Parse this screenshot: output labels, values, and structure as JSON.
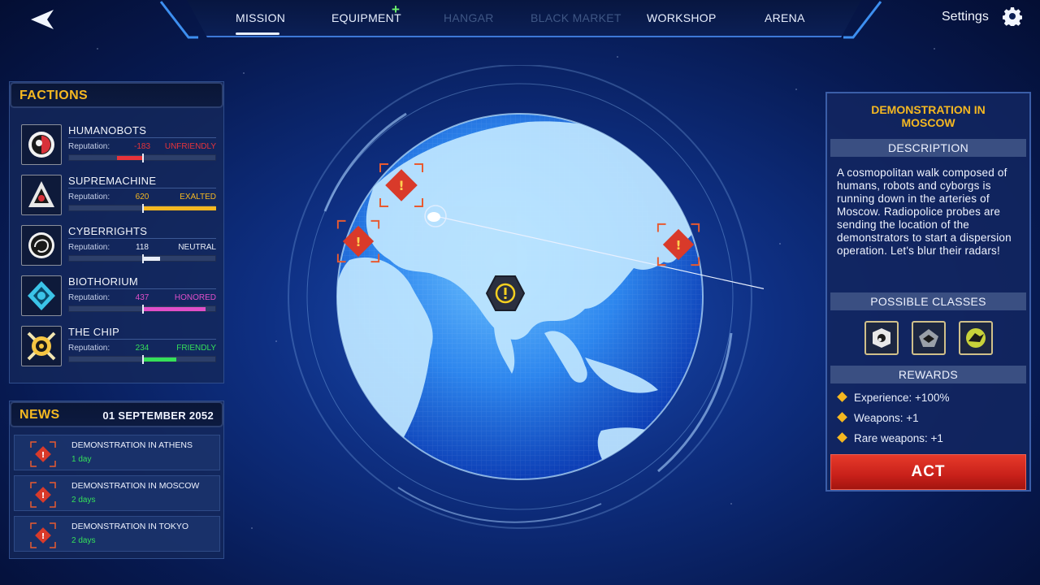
{
  "nav": {
    "tabs": [
      {
        "label": "MISSION",
        "state": "active"
      },
      {
        "label": "EQUIPMENT",
        "state": "normal"
      },
      {
        "label": "HANGAR",
        "state": "disabled"
      },
      {
        "label": "BLACK MARKET",
        "state": "disabled"
      },
      {
        "label": "WORKSHOP",
        "state": "normal"
      },
      {
        "label": "ARENA",
        "state": "normal"
      }
    ],
    "equipment_badge": "+",
    "settings_label": "Settings"
  },
  "factions": {
    "title": "FACTIONS",
    "rep_label": "Reputation:",
    "items": [
      {
        "name": "HUMANOBOTS",
        "value": "-183",
        "status": "UNFRIENDLY",
        "color": "#e8333a",
        "level": -0.35
      },
      {
        "name": "SUPREMACHINE",
        "value": "620",
        "status": "EXALTED",
        "color": "#f5b821",
        "level": 1.0
      },
      {
        "name": "CYBERRIGHTS",
        "value": "118",
        "status": "NEUTRAL",
        "color": "#e8edf8",
        "level": 0.23
      },
      {
        "name": "BIOTHORIUM",
        "value": "437",
        "status": "HONORED",
        "color": "#e04fc9",
        "level": 0.85
      },
      {
        "name": "THE CHIP",
        "value": "234",
        "status": "FRIENDLY",
        "color": "#35e05a",
        "level": 0.46
      }
    ]
  },
  "news": {
    "title": "NEWS",
    "date": "01 SEPTEMBER 2052",
    "items": [
      {
        "title": "DEMONSTRATION IN ATHENS",
        "days": "1 day"
      },
      {
        "title": "DEMONSTRATION IN MOSCOW",
        "days": "2 days"
      },
      {
        "title": "DEMONSTRATION IN TOKYO",
        "days": "2 days"
      }
    ]
  },
  "mission": {
    "title": "DEMONSTRATION IN MOSCOW",
    "description_heading": "DESCRIPTION",
    "description": "A cosmopolitan walk composed of humans, robots and cyborgs is running down in the arteries of Moscow. Radiopolice probes are sending the location of the demonstrators to start a dispersion operation. Let's blur their radars!",
    "classes_heading": "POSSIBLE CLASSES",
    "classes": [
      "class-scout-icon",
      "class-tank-icon",
      "class-striker-icon"
    ],
    "rewards_heading": "REWARDS",
    "rewards": [
      "Experience: +100%",
      "Weapons: +1",
      "Rare weapons: +1"
    ],
    "act_label": "ACT"
  },
  "colors": {
    "accent": "#f5b821",
    "danger": "#d93a2a",
    "positive": "#35e05a"
  }
}
